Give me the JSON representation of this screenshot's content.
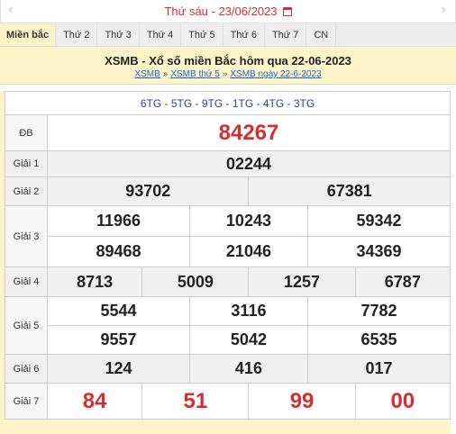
{
  "datebar": {
    "text": "Thứ sáu -  23/06/2023",
    "calendar_icon": "calendar-icon",
    "prev_icon": "chevron-left-icon",
    "next_icon": "chevron-right-icon"
  },
  "tabs": [
    "Miền bắc",
    "Thứ 2",
    "Thứ 3",
    "Thứ 4",
    "Thứ 5",
    "Thứ 6",
    "Thứ 7",
    "CN"
  ],
  "header": {
    "title": "XSMB - Xổ số miền Bắc hôm qua 22-06-2023",
    "crumbs": [
      "XSMB",
      "XSMB thứ 5",
      "XSMB ngày 22-6-2023"
    ],
    "separator": "»"
  },
  "codes": "6TG - 5TG - 9TG - 1TG - 4TG - 3TG",
  "prizes": {
    "db": {
      "label": "ĐB",
      "values": [
        "84267"
      ]
    },
    "g1": {
      "label": "Giải 1",
      "values": [
        "02244"
      ]
    },
    "g2": {
      "label": "Giải 2",
      "values": [
        "93702",
        "67381"
      ]
    },
    "g3": {
      "label": "Giải 3",
      "values": [
        "11966",
        "10243",
        "59342",
        "89468",
        "21046",
        "34369"
      ]
    },
    "g4": {
      "label": "Giải 4",
      "values": [
        "8713",
        "5009",
        "1257",
        "6787"
      ]
    },
    "g5": {
      "label": "Giải 5",
      "values": [
        "5544",
        "3116",
        "7782",
        "9557",
        "5042",
        "6535"
      ]
    },
    "g6": {
      "label": "Giải 6",
      "values": [
        "124",
        "416",
        "017"
      ]
    },
    "g7": {
      "label": "Giải 7",
      "values": [
        "84",
        "51",
        "99",
        "00"
      ]
    }
  },
  "colors": {
    "accent_red": "#d32f2f",
    "header_bg": "#fdf5c9",
    "link_blue": "#1e63c8",
    "code_blue": "#2a3fa0"
  }
}
